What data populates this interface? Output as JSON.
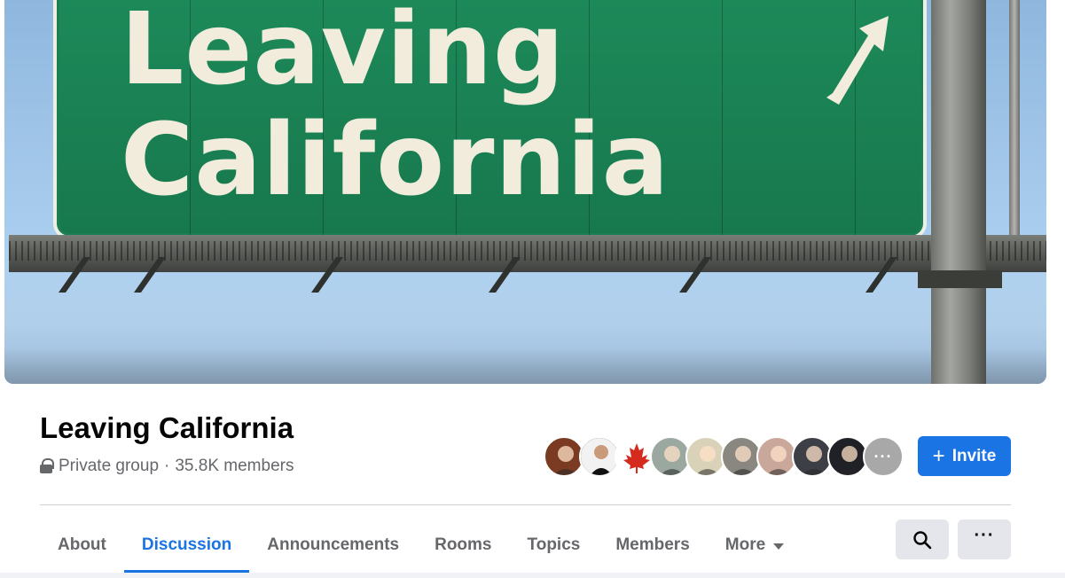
{
  "cover": {
    "sign_line1": "Leaving",
    "sign_line2": "California",
    "alt": "cover-photo"
  },
  "group": {
    "name": "Leaving California",
    "privacy": "Private group",
    "separator": "·",
    "members": "35.8K members"
  },
  "member_avatars": [
    {
      "name": "member-avatar-1",
      "color": "#7a3b22"
    },
    {
      "name": "member-avatar-2",
      "color": "#2b2b2b"
    },
    {
      "name": "member-avatar-3",
      "color": "#ffffff"
    },
    {
      "name": "member-avatar-4",
      "color": "#9aa8a0"
    },
    {
      "name": "member-avatar-5",
      "color": "#d9d2b8"
    },
    {
      "name": "member-avatar-6",
      "color": "#8a8680"
    },
    {
      "name": "member-avatar-7",
      "color": "#c9a79a"
    },
    {
      "name": "member-avatar-8",
      "color": "#3c3f45"
    },
    {
      "name": "member-avatar-9",
      "color": "#1f2127"
    },
    {
      "name": "member-avatar-more",
      "color": "#a8a8a8",
      "label": "···"
    }
  ],
  "actions": {
    "invite_label": "Invite",
    "invite_icon": "plus-icon",
    "accent": "#1b74e4"
  },
  "tabs": [
    {
      "label": "About",
      "active": false
    },
    {
      "label": "Discussion",
      "active": true
    },
    {
      "label": "Announcements",
      "active": false
    },
    {
      "label": "Rooms",
      "active": false
    },
    {
      "label": "Topics",
      "active": false
    },
    {
      "label": "Members",
      "active": false
    },
    {
      "label": "More",
      "active": false,
      "dropdown": true
    }
  ],
  "toolbar": {
    "search_icon": "search-icon",
    "more_label": "···"
  }
}
